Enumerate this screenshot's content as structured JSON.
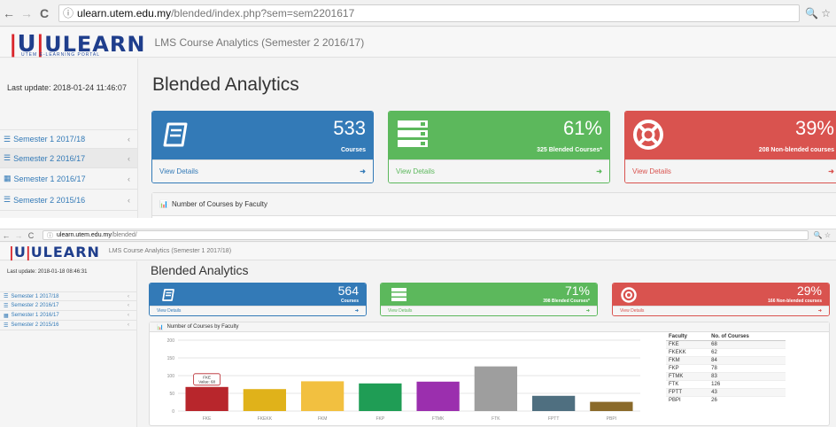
{
  "shot1": {
    "browser": {
      "back": "←",
      "forward": "→",
      "reload": "C",
      "info": "ⓘ",
      "url_host": "ulearn.utem.edu.my",
      "url_path": "/blended/index.php?sem=sem2201617",
      "right": "🔍 ☆"
    },
    "header": {
      "logo_letter": "U",
      "logo_text": "ULEARN",
      "logo_tagline": "UTEM E-LEARNING PORTAL",
      "title": "LMS Course Analytics (Semester 2 2016/17)"
    },
    "last_update": "Last update: 2018-01-24 11:46:07",
    "semesters": [
      {
        "label": "Semester 1 2017/18"
      },
      {
        "label": "Semester 2 2016/17"
      },
      {
        "label": "Semester 1 2016/17"
      },
      {
        "label": "Semester 2 2015/16"
      }
    ],
    "page_title": "Blended Analytics",
    "panels": {
      "courses": {
        "value": "533",
        "label": "Courses",
        "link": "View Details"
      },
      "blended": {
        "value": "61%",
        "label": "325 Blended Courses*",
        "link": "View Details"
      },
      "nonblended": {
        "value": "39%",
        "label": "208 Non-blended courses",
        "link": "View Details"
      }
    },
    "chart_heading": "Number of Courses by Faculty"
  },
  "shot2": {
    "browser": {
      "back": "←",
      "forward": "→",
      "reload": "C",
      "info": "ⓘ",
      "url_host": "ulearn.utem.edu.my",
      "url_path": "/blended/",
      "right": "🔍 ☆"
    },
    "header": {
      "logo_letter": "U",
      "logo_text": "ULEARN",
      "title": "LMS Course Analytics (Semester 1 2017/18)"
    },
    "last_update": "Last update: 2018-01-18 08:46:31",
    "semesters": [
      {
        "label": "Semester 1 2017/18"
      },
      {
        "label": "Semester 2 2016/17"
      },
      {
        "label": "Semester 1 2016/17"
      },
      {
        "label": "Semester 2 2015/16"
      }
    ],
    "page_title": "Blended Analytics",
    "panels": {
      "courses": {
        "value": "564",
        "label": "Courses",
        "link": "View Details"
      },
      "blended": {
        "value": "71%",
        "label": "398 Blended Courses*",
        "link": "View Details"
      },
      "nonblended": {
        "value": "29%",
        "label": "166 Non-blended courses",
        "link": "View Details"
      }
    },
    "chart_heading": "Number of Courses by Faculty",
    "tooltip": {
      "title": "FKE",
      "text": "Value: 68"
    },
    "table": {
      "headers": [
        "Faculty",
        "No. of Courses"
      ],
      "rows": [
        [
          "FKE",
          "68"
        ],
        [
          "FKEKK",
          "62"
        ],
        [
          "FKM",
          "84"
        ],
        [
          "FKP",
          "78"
        ],
        [
          "FTMK",
          "83"
        ],
        [
          "FTK",
          "126"
        ],
        [
          "FPTT",
          "43"
        ],
        [
          "PBPI",
          "26"
        ]
      ]
    },
    "chart_data": {
      "type": "bar",
      "categories": [
        "FKE",
        "FKEKK",
        "FKM",
        "FKP",
        "FTMK",
        "FTK",
        "FPTT",
        "PBPI"
      ],
      "values": [
        68,
        62,
        84,
        78,
        83,
        126,
        43,
        26
      ],
      "colors": [
        "#b8262c",
        "#e0b21a",
        "#f2c040",
        "#1f9d55",
        "#9b2fae",
        "#9e9e9e",
        "#4f6f80",
        "#8a6a2a"
      ],
      "yticks": [
        "200",
        "150",
        "100",
        "50",
        "0"
      ],
      "ylim": [
        0,
        200
      ],
      "title": "",
      "xlabel": "",
      "ylabel": ""
    }
  },
  "colors": {
    "primary": "#337ab7",
    "success": "#5cb85c",
    "danger": "#d9534f",
    "logo_blue": "#1f3e8c",
    "logo_red": "#d9262c"
  }
}
